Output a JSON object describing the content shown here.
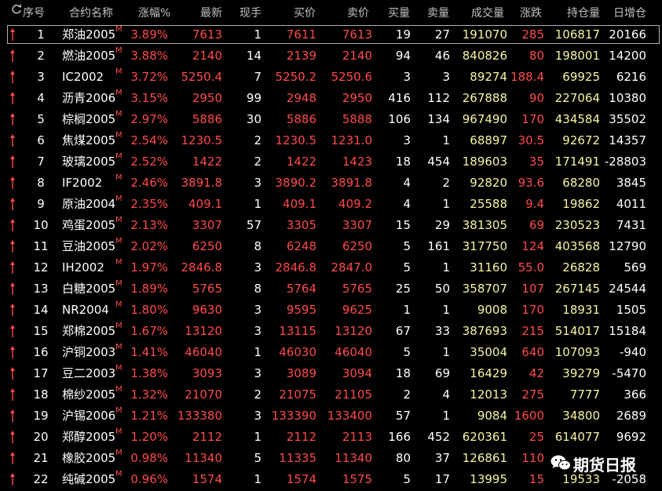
{
  "header": {
    "refresh_icon": "refresh-icon",
    "seq": "序号",
    "name": "合约名称",
    "pct": "涨幅%",
    "last": "最新",
    "vol_now": "现手",
    "bid": "买价",
    "ask": "卖价",
    "bid_vol": "买量",
    "ask_vol": "卖量",
    "volume": "成交量",
    "change": "涨跌",
    "open_interest": "持仓量",
    "oi_change": "日增仓"
  },
  "colors": {
    "up": "#ff4a4a",
    "neutral": "#ffffff",
    "volume": "#f5f5a0",
    "background": "#000000"
  },
  "rows": [
    {
      "seq": "1",
      "name": "郑油2005",
      "mark": "M",
      "pct": "3.89%",
      "last": "7613",
      "now": "1",
      "bid": "7611",
      "ask": "7613",
      "bidv": "19",
      "askv": "27",
      "vol": "191070",
      "chg": "285",
      "oi": "106817",
      "oichg": "20166",
      "selected": true
    },
    {
      "seq": "2",
      "name": "燃油2005",
      "mark": "M",
      "pct": "3.88%",
      "last": "2140",
      "now": "14",
      "bid": "2139",
      "ask": "2140",
      "bidv": "94",
      "askv": "46",
      "vol": "840826",
      "chg": "80",
      "oi": "198001",
      "oichg": "14200"
    },
    {
      "seq": "3",
      "name": "IC2002",
      "mark": "M",
      "pct": "3.72%",
      "last": "5250.4",
      "now": "7",
      "bid": "5250.2",
      "ask": "5250.6",
      "bidv": "3",
      "askv": "3",
      "vol": "89274",
      "chg": "188.4",
      "oi": "69925",
      "oichg": "6216"
    },
    {
      "seq": "4",
      "name": "沥青2006",
      "mark": "M",
      "pct": "3.15%",
      "last": "2950",
      "now": "99",
      "bid": "2948",
      "ask": "2950",
      "bidv": "416",
      "askv": "112",
      "vol": "267888",
      "chg": "90",
      "oi": "227064",
      "oichg": "10380"
    },
    {
      "seq": "5",
      "name": "棕榈2005",
      "mark": "M",
      "pct": "2.97%",
      "last": "5886",
      "now": "30",
      "bid": "5886",
      "ask": "5888",
      "bidv": "106",
      "askv": "134",
      "vol": "967490",
      "chg": "170",
      "oi": "434584",
      "oichg": "35502"
    },
    {
      "seq": "6",
      "name": "焦煤2005",
      "mark": "M",
      "pct": "2.54%",
      "last": "1230.5",
      "now": "2",
      "bid": "1230.5",
      "ask": "1231.0",
      "bidv": "3",
      "askv": "1",
      "vol": "68897",
      "chg": "30.5",
      "oi": "92672",
      "oichg": "14357"
    },
    {
      "seq": "7",
      "name": "玻璃2005",
      "mark": "M",
      "pct": "2.52%",
      "last": "1422",
      "now": "2",
      "bid": "1422",
      "ask": "1423",
      "bidv": "18",
      "askv": "454",
      "vol": "189603",
      "chg": "35",
      "oi": "171491",
      "oichg": "-28803"
    },
    {
      "seq": "8",
      "name": "IF2002",
      "mark": "M",
      "pct": "2.46%",
      "last": "3891.8",
      "now": "3",
      "bid": "3890.2",
      "ask": "3891.8",
      "bidv": "4",
      "askv": "2",
      "vol": "92820",
      "chg": "93.6",
      "oi": "68280",
      "oichg": "3845"
    },
    {
      "seq": "9",
      "name": "原油2004",
      "mark": "M",
      "pct": "2.35%",
      "last": "409.1",
      "now": "1",
      "bid": "409.1",
      "ask": "409.2",
      "bidv": "4",
      "askv": "1",
      "vol": "25588",
      "chg": "9.4",
      "oi": "19862",
      "oichg": "4011"
    },
    {
      "seq": "10",
      "name": "鸡蛋2005",
      "mark": "M",
      "pct": "2.13%",
      "last": "3307",
      "now": "57",
      "bid": "3305",
      "ask": "3307",
      "bidv": "15",
      "askv": "29",
      "vol": "381305",
      "chg": "69",
      "oi": "230523",
      "oichg": "7431"
    },
    {
      "seq": "11",
      "name": "豆油2005",
      "mark": "M",
      "pct": "2.02%",
      "last": "6250",
      "now": "8",
      "bid": "6248",
      "ask": "6250",
      "bidv": "5",
      "askv": "161",
      "vol": "317750",
      "chg": "124",
      "oi": "403568",
      "oichg": "12790"
    },
    {
      "seq": "12",
      "name": "IH2002",
      "mark": "M",
      "pct": "1.97%",
      "last": "2846.8",
      "now": "3",
      "bid": "2846.8",
      "ask": "2847.0",
      "bidv": "5",
      "askv": "1",
      "vol": "31160",
      "chg": "55.0",
      "oi": "26828",
      "oichg": "569"
    },
    {
      "seq": "13",
      "name": "白糖2005",
      "mark": "M",
      "pct": "1.89%",
      "last": "5765",
      "now": "8",
      "bid": "5764",
      "ask": "5765",
      "bidv": "25",
      "askv": "50",
      "vol": "358707",
      "chg": "107",
      "oi": "267145",
      "oichg": "24544"
    },
    {
      "seq": "14",
      "name": "NR2004",
      "mark": "M",
      "pct": "1.80%",
      "last": "9630",
      "now": "3",
      "bid": "9595",
      "ask": "9625",
      "bidv": "1",
      "askv": "1",
      "vol": "9008",
      "chg": "170",
      "oi": "18931",
      "oichg": "1505"
    },
    {
      "seq": "15",
      "name": "郑棉2005",
      "mark": "M",
      "pct": "1.67%",
      "last": "13120",
      "now": "3",
      "bid": "13115",
      "ask": "13120",
      "bidv": "67",
      "askv": "33",
      "vol": "387693",
      "chg": "215",
      "oi": "514017",
      "oichg": "15184"
    },
    {
      "seq": "16",
      "name": "沪铜2003",
      "mark": "M",
      "pct": "1.41%",
      "last": "46040",
      "now": "1",
      "bid": "46030",
      "ask": "46040",
      "bidv": "5",
      "askv": "1",
      "vol": "35004",
      "chg": "640",
      "oi": "107093",
      "oichg": "-940"
    },
    {
      "seq": "17",
      "name": "豆二2003",
      "mark": "M",
      "pct": "1.38%",
      "last": "3093",
      "now": "3",
      "bid": "3089",
      "ask": "3094",
      "bidv": "18",
      "askv": "69",
      "vol": "16429",
      "chg": "42",
      "oi": "39279",
      "oichg": "-5470"
    },
    {
      "seq": "18",
      "name": "棉纱2005",
      "mark": "M",
      "pct": "1.32%",
      "last": "21070",
      "now": "2",
      "bid": "21075",
      "ask": "21105",
      "bidv": "2",
      "askv": "4",
      "vol": "12013",
      "chg": "275",
      "oi": "7777",
      "oichg": "366"
    },
    {
      "seq": "19",
      "name": "沪锡2006",
      "mark": "M",
      "pct": "1.21%",
      "last": "133380",
      "now": "3",
      "bid": "133390",
      "ask": "133400",
      "bidv": "57",
      "askv": "1",
      "vol": "9084",
      "chg": "1600",
      "oi": "34800",
      "oichg": "2689"
    },
    {
      "seq": "20",
      "name": "郑醇2005",
      "mark": "M",
      "pct": "1.20%",
      "last": "2112",
      "now": "1",
      "bid": "2112",
      "ask": "2113",
      "bidv": "166",
      "askv": "452",
      "vol": "620361",
      "chg": "25",
      "oi": "614077",
      "oichg": "9692"
    },
    {
      "seq": "21",
      "name": "橡胶2005",
      "mark": "M",
      "pct": "0.98%",
      "last": "11340",
      "now": "5",
      "bid": "11335",
      "ask": "11340",
      "bidv": "80",
      "askv": "37",
      "vol": "126861",
      "chg": "110",
      "oi": "",
      "oichg": ""
    },
    {
      "seq": "22",
      "name": "纯碱2005",
      "mark": "M",
      "pct": "0.96%",
      "last": "1574",
      "now": "1",
      "bid": "1574",
      "ask": "1575",
      "bidv": "5",
      "askv": "17",
      "vol": "13995",
      "chg": "15",
      "oi": "19533",
      "oichg": "-2058"
    }
  ],
  "watermark": {
    "icon": "wechat-icon",
    "text": "期货日报"
  }
}
